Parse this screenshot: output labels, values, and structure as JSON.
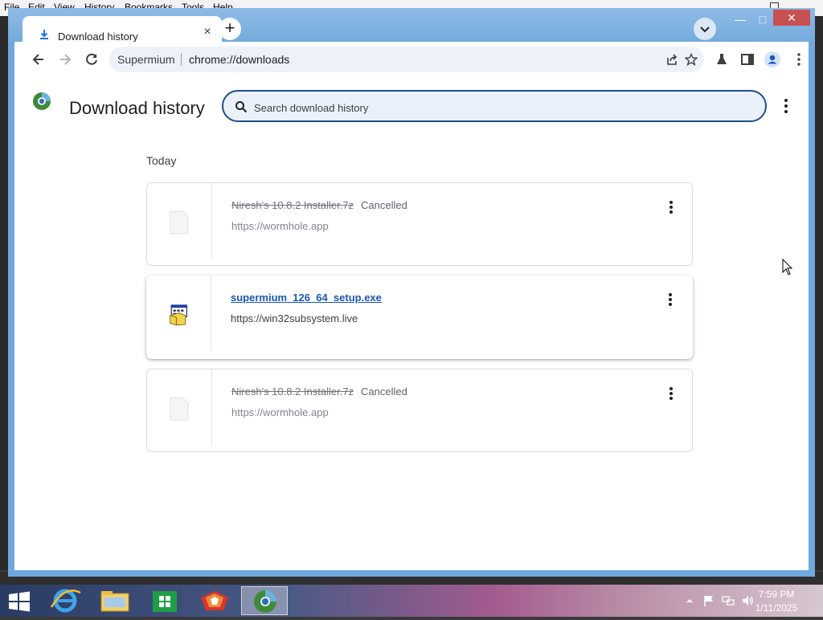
{
  "background_app": {
    "menu": [
      "File",
      "Edit",
      "View",
      "History",
      "Bookmarks",
      "Tools",
      "Help"
    ]
  },
  "tab": {
    "title": "Download history",
    "close_glyph": "×",
    "new_tab_glyph": "+"
  },
  "window_controls": {
    "minimize": "—",
    "maximize": "□",
    "close": "✕"
  },
  "omnibox": {
    "site_label": "Supermium",
    "url": "chrome://downloads"
  },
  "page": {
    "title": "Download history",
    "search_placeholder": "Search download history",
    "section_label": "Today"
  },
  "downloads": [
    {
      "file_name": "Niresh's 10.8.2 Installer.7z",
      "status": "Cancelled",
      "url": "https://wormhole.app",
      "state": "cancelled"
    },
    {
      "file_name": "supermium_126_64_setup.exe",
      "status": "",
      "url": "https://win32subsystem.live",
      "state": "complete"
    },
    {
      "file_name": "Niresh's 10.8.2 Installer.7z",
      "status": "Cancelled",
      "url": "https://wormhole.app",
      "state": "cancelled"
    }
  ],
  "taskbar": {
    "time": "7:59 PM",
    "date": "1/11/2025"
  },
  "colors": {
    "titlebar": "#74abdc",
    "search_border": "#1f4e8c",
    "link": "#1a56b5"
  }
}
